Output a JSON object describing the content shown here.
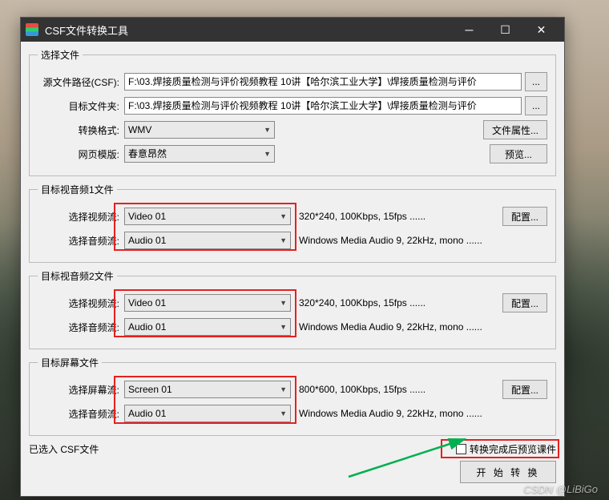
{
  "window": {
    "title": "CSF文件转换工具"
  },
  "group_file": {
    "legend": "选择文件",
    "source_label": "源文件路径(CSF):",
    "source_path": "F:\\03.焊接质量检测与评价视频教程 10讲【哈尔滨工业大学】\\焊接质量检测与评价",
    "browse": "...",
    "target_label": "目标文件夹:",
    "target_path": "F:\\03.焊接质量检测与评价视频教程 10讲【哈尔滨工业大学】\\焊接质量检测与评价",
    "format_label": "转换格式:",
    "format_value": "WMV",
    "props_btn": "文件属性...",
    "template_label": "网页模版:",
    "template_value": "春意昂然",
    "preview_btn": "预览..."
  },
  "group_av1": {
    "legend": "目标视音频1文件",
    "video_label": "选择视频流:",
    "video_value": "Video 01",
    "video_info": "320*240, 100Kbps, 15fps ......",
    "audio_label": "选择音频流:",
    "audio_value": "Audio 01",
    "audio_info": "Windows Media Audio 9, 22kHz, mono ......",
    "config_btn": "配置..."
  },
  "group_av2": {
    "legend": "目标视音频2文件",
    "video_label": "选择视频流:",
    "video_value": "Video 01",
    "video_info": "320*240, 100Kbps, 15fps ......",
    "audio_label": "选择音频流:",
    "audio_value": "Audio 01",
    "audio_info": "Windows Media Audio 9, 22kHz, mono ......",
    "config_btn": "配置..."
  },
  "group_screen": {
    "legend": "目标屏幕文件",
    "screen_label": "选择屏幕流:",
    "screen_value": "Screen 01",
    "screen_info": "800*600, 100Kbps, 15fps ......",
    "audio_label": "选择音频流:",
    "audio_value": "Audio 01",
    "audio_info": "Windows Media Audio 9, 22kHz, mono ......",
    "config_btn": "配置..."
  },
  "footer": {
    "selected_label": "已选入 CSF文件",
    "preview_after_label": "转换完成后预览课件",
    "preview_after_checked": false,
    "start_btn": "开 始 转 换"
  },
  "watermark": "CSDN @LiBiGo"
}
